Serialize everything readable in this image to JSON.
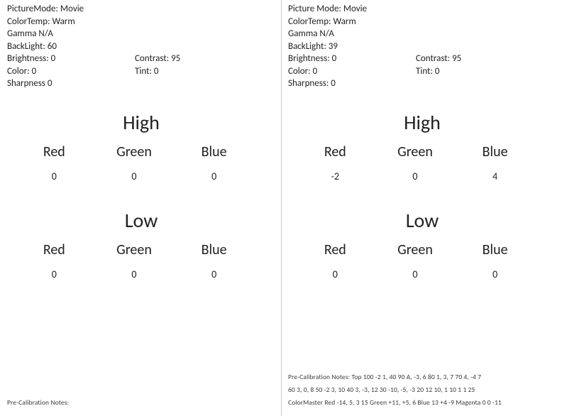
{
  "labels": {
    "picture_mode": "PictureMode",
    "picture_mode2": "Picture Mode",
    "color_temp": "ColorTemp",
    "gamma": "Gamma",
    "backlight": "BackLight",
    "brightness": "Brightness",
    "contrast": "Contrast",
    "color": "Color",
    "tint": "Tint",
    "sharpness": "Sharpness",
    "high": "High",
    "low": "Low",
    "red": "Red",
    "green": "Green",
    "blue": "Blue"
  },
  "left": {
    "picture_mode": "Movie",
    "color_temp": "Warm",
    "gamma": "N/A",
    "backlight": "60",
    "brightness": "0",
    "contrast": "95",
    "color": "0",
    "tint": "0",
    "sharpness": "0",
    "high": {
      "red": "0",
      "green": "0",
      "blue": "0"
    },
    "low": {
      "red": "0",
      "green": "0",
      "blue": "0"
    },
    "notes_title": "Pre-Calibration Notes:",
    "notes_body": ""
  },
  "right": {
    "picture_mode": "Movie",
    "color_temp": "Warm",
    "gamma": "N/A",
    "backlight": "39",
    "brightness": "0",
    "contrast": "95",
    "color": "0",
    "tint": "0",
    "sharpness": "0",
    "high": {
      "red": "-2",
      "green": "0",
      "blue": "4"
    },
    "low": {
      "red": "0",
      "green": "0",
      "blue": "0"
    },
    "notes_title": "Pre-Calibration Notes: Top 100   -2   1, 40 90   A, -3, 6 80   1,   3, 7\n70   4, -4   7",
    "notes_line2": "60   3, 0, 8 50   -2   3, 10 40   3, -3, 12 30 -10, -5, -3\n20   12   10,  1 10 1   1  25",
    "notes_line3": "ColorMaster   Red  -14,  5, 3 15 Green   +11, +5,   6\nBlue   13  +4  -9 Magenta   0    0   -11"
  }
}
